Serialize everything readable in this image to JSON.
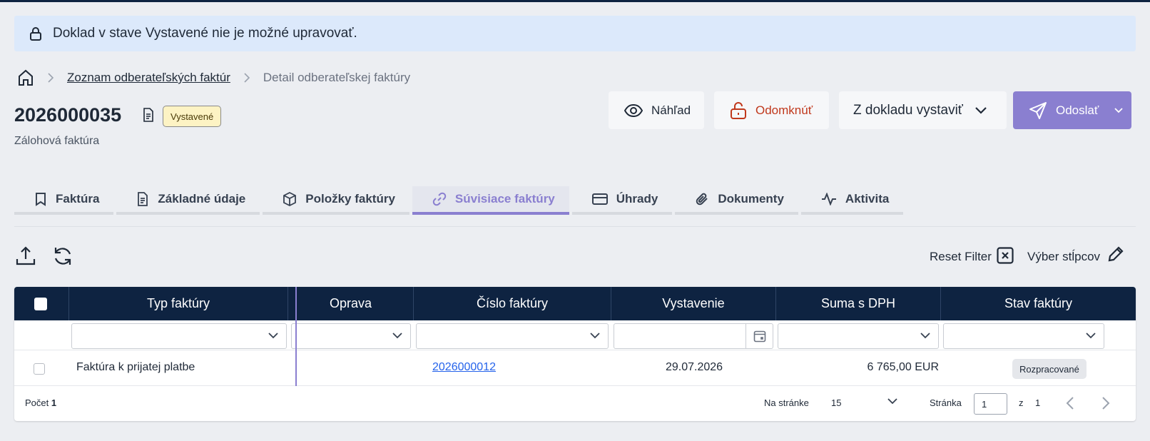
{
  "alert": {
    "text": "Doklad v stave Vystavené nie je možné upravovať."
  },
  "breadcrumb": {
    "link": "Zoznam odberateľských faktúr",
    "current": "Detail odberateľskej faktúry"
  },
  "document": {
    "number": "2026000035",
    "status": "Vystavené",
    "type": "Zálohová faktúra"
  },
  "actions": {
    "preview": "Náhľad",
    "unlock": "Odomknúť",
    "create_from": "Z dokladu vystaviť",
    "send": "Odoslať"
  },
  "tabs": [
    {
      "label": "Faktúra",
      "icon": "book-icon"
    },
    {
      "label": "Základné údaje",
      "icon": "file-text-icon"
    },
    {
      "label": "Položky faktúry",
      "icon": "package-icon"
    },
    {
      "label": "Súvisiace faktúry",
      "icon": "link-icon",
      "active": true
    },
    {
      "label": "Úhrady",
      "icon": "credit-card-icon"
    },
    {
      "label": "Dokumenty",
      "icon": "paperclip-icon"
    },
    {
      "label": "Aktivita",
      "icon": "activity-icon"
    }
  ],
  "toolbar": {
    "reset_filter": "Reset Filter",
    "column_select": "Výber stĺpcov"
  },
  "grid": {
    "columns": [
      "Typ faktúry",
      "Oprava",
      "Číslo faktúry",
      "Vystavenie",
      "Suma s DPH",
      "Stav faktúry"
    ],
    "rows": [
      {
        "type": "Faktúra k prijatej platbe",
        "correction": "",
        "number": "2026000012",
        "issued": "29.07.2026",
        "amount": "6 765,00 EUR",
        "status": "Rozpracované"
      }
    ]
  },
  "footer": {
    "count_label": "Počet",
    "count_value": "1",
    "per_page_label": "Na stránke",
    "per_page_value": "15",
    "page_label": "Stránka",
    "page_value": "1",
    "of_label": "z",
    "total_pages": "1"
  },
  "colors": {
    "accent": "#8a7fd0",
    "header_bg": "#0e2341",
    "alert_bg": "#dce9fb",
    "unlock": "#c0381c",
    "status_chip_bg": "#fdf3c4"
  }
}
